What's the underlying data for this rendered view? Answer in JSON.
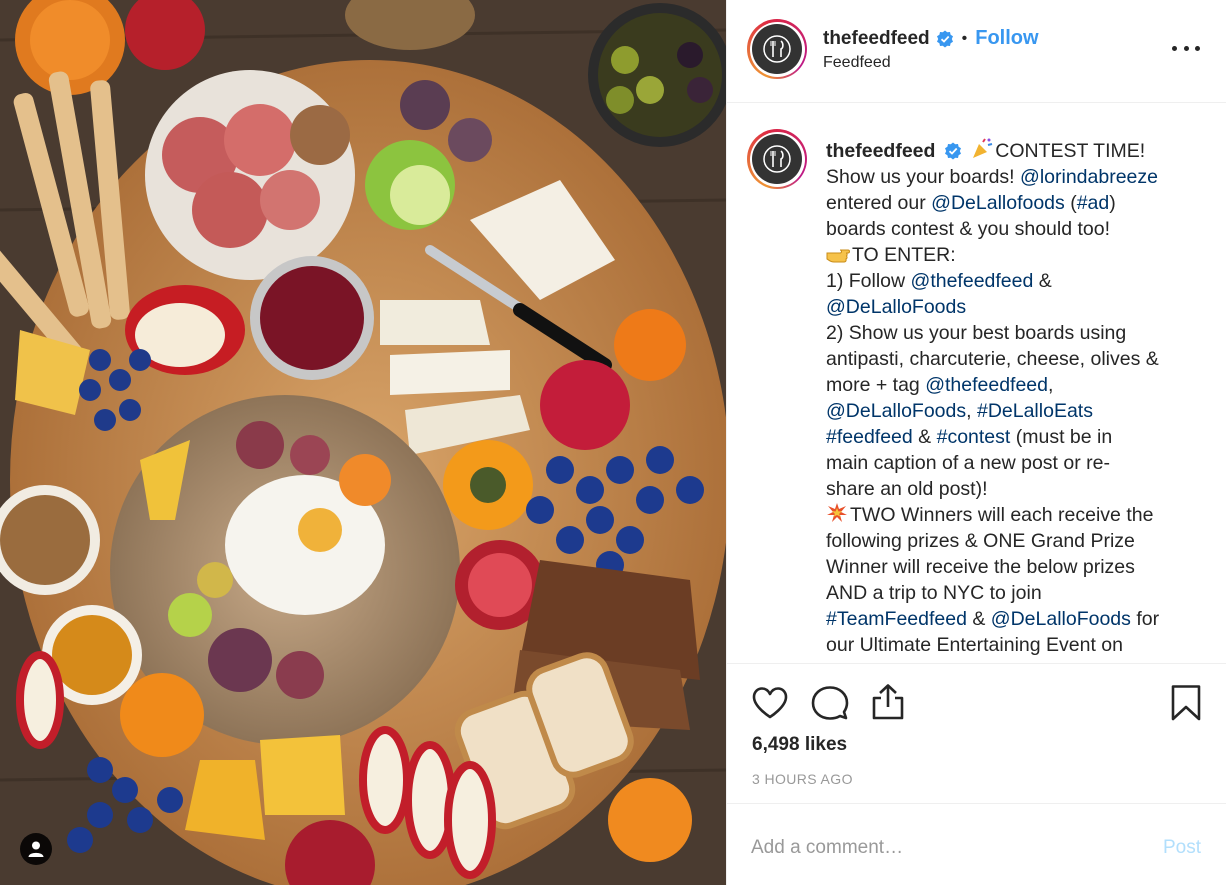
{
  "post": {
    "username": "thefeedfeed",
    "verified": true,
    "follow_label": "Follow",
    "dot": "•",
    "subtitle": "Feedfeed",
    "image_alt": "Charcuterie board with cheeses, fruits, bread and cured meats"
  },
  "caption": {
    "username": "thefeedfeed",
    "emojis": {
      "party": "party-popper-icon",
      "point": "pointing-hand-icon",
      "boom": "collision-icon"
    },
    "segments": {
      "l1": "CONTEST TIME!",
      "l2a": "Show us your boards! ",
      "l2b": "@lorindabreeze",
      "l3a": "entered our ",
      "l3b": "@DeLallofoods",
      "l3c": " (",
      "l3d": "#ad",
      "l3e": ")",
      "l4": "boards contest & you should too!",
      "l5": "TO ENTER:",
      "l6a": "1) Follow ",
      "l6b": "@thefeedfeed",
      "l6c": " &",
      "l7": "@DeLalloFoods",
      "l8": "2) Show us your best boards using",
      "l9": "antipasti, charcuterie, cheese, olives &",
      "l10a": "more + tag ",
      "l10b": "@thefeedfeed",
      "l10c": ",",
      "l11a": "@DeLalloFoods",
      "l11b": ", ",
      "l11c": "#DeLalloEats",
      "l12a": "#feedfeed",
      "l12b": " & ",
      "l12c": "#contest",
      "l12d": " (must be in",
      "l13": "main caption of a new post or re-",
      "l14": "share an old post)!",
      "l15": "TWO Winners will each receive the",
      "l16": "following prizes & ONE Grand Prize",
      "l17": "Winner will receive the below prizes",
      "l18": "AND a trip to NYC to join",
      "l19a": "#TeamFeedfeed",
      "l19b": " & ",
      "l19c": "@DeLalloFoods",
      "l19d": " for",
      "l20": "our Ultimate Entertaining Event on"
    }
  },
  "actions": {
    "like_icon": "heart-icon",
    "comment_icon": "comment-bubble-icon",
    "share_icon": "share-icon",
    "save_icon": "bookmark-icon"
  },
  "likes": "6,498 likes",
  "time_ago": "3 HOURS AGO",
  "comment": {
    "placeholder": "Add a comment…",
    "post_label": "Post"
  },
  "colors": {
    "link": "#003569",
    "follow": "#3897f0",
    "post_disabled": "#b2dffc",
    "meta": "#999999"
  }
}
